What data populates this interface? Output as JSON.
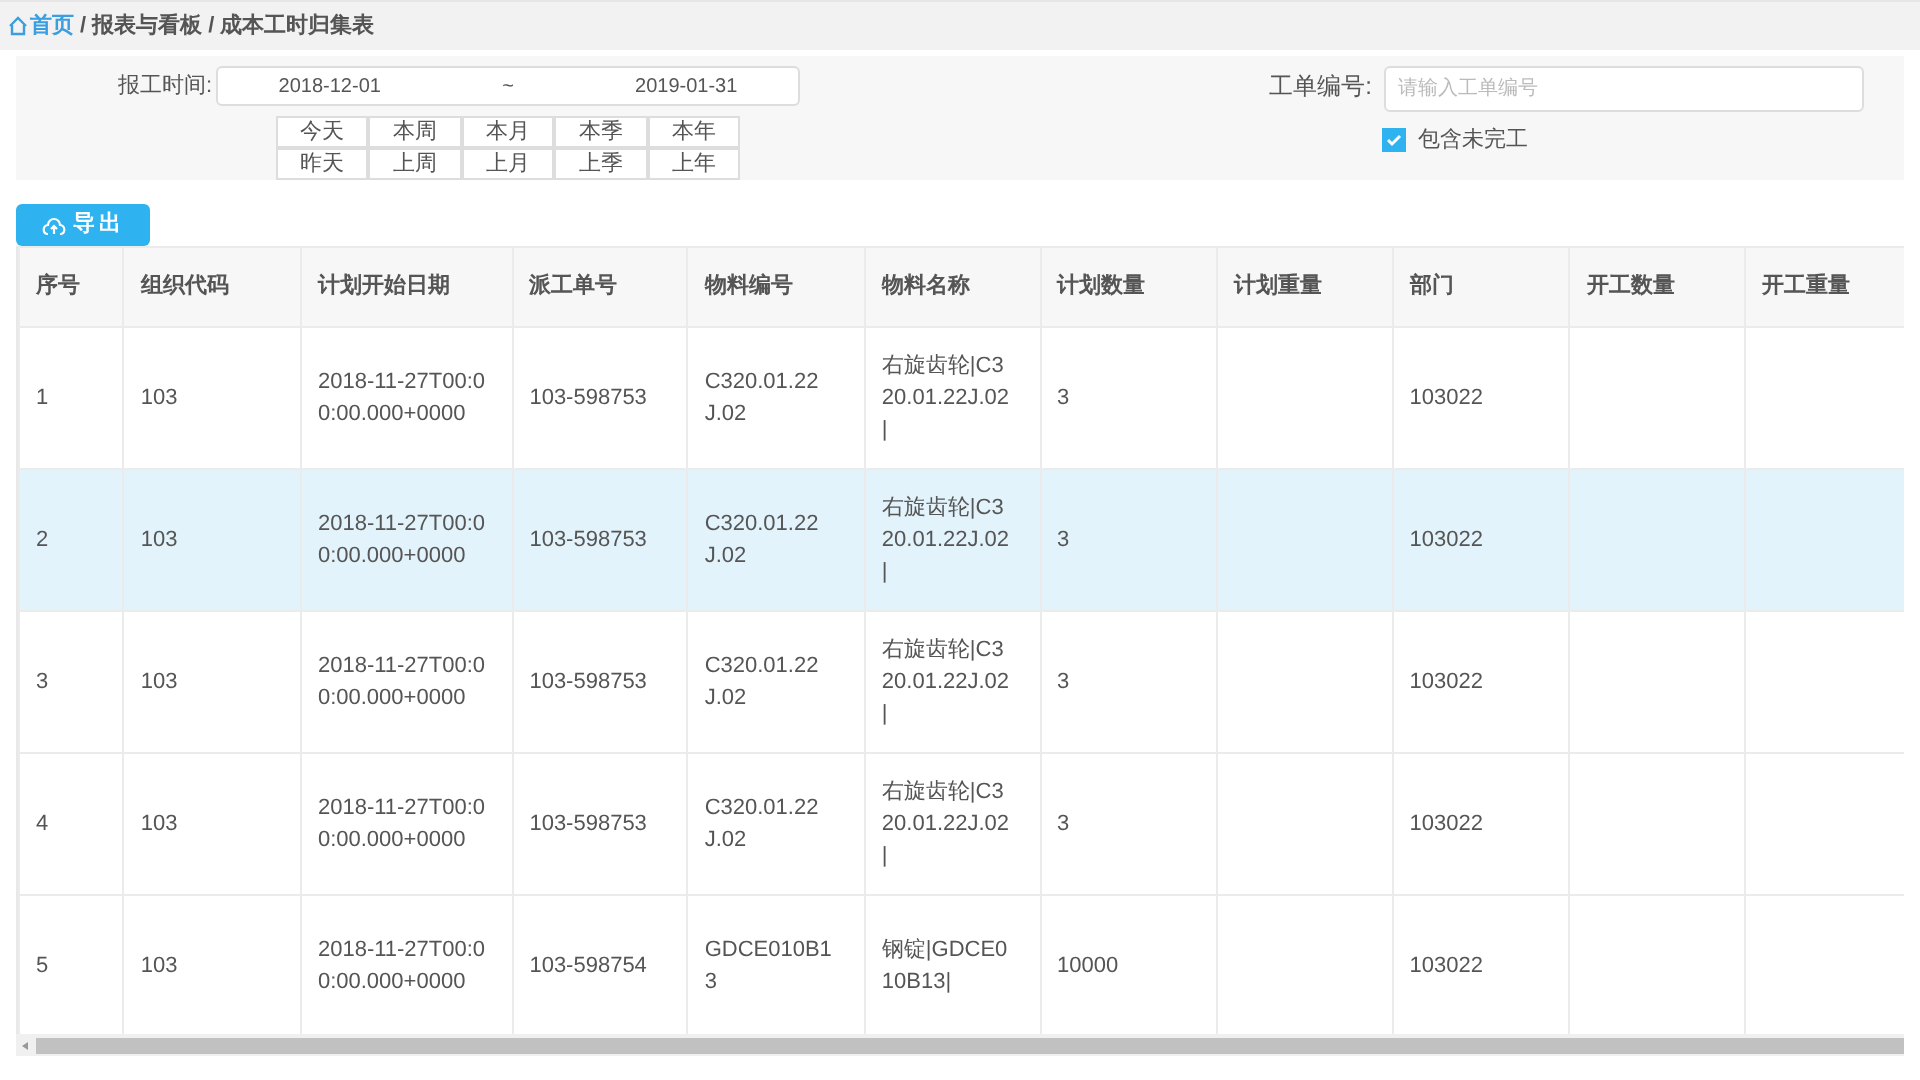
{
  "breadcrumb": {
    "home": "首页",
    "separator": "/",
    "items": [
      "报表与看板",
      "成本工时归集表"
    ]
  },
  "filter": {
    "date_label": "报工时间:",
    "date_start": "2018-12-01",
    "date_sep": "~",
    "date_end": "2019-01-31",
    "quick_ranges": [
      "今天",
      "本周",
      "本月",
      "本季",
      "本年",
      "昨天",
      "上周",
      "上月",
      "上季",
      "上年"
    ],
    "order_label": "工单编号:",
    "order_placeholder": "请输入工单编号",
    "include_unfinished": {
      "label": "包含未完工",
      "checked": true
    }
  },
  "export_button": "导出",
  "table": {
    "columns": [
      "序号",
      "组织代码",
      "计划开始日期",
      "派工单号",
      "物料编号",
      "物料名称",
      "计划数量",
      "计划重量",
      "部门",
      "开工数量",
      "开工重量"
    ],
    "rows": [
      {
        "selected": false,
        "cells": [
          "1",
          "103",
          "2018-11-27T00:00:00.000+0000",
          "103-598753",
          "C320.01.22J.02",
          "右旋齿轮|C320.01.22J.02|",
          "3",
          "",
          "103022",
          "",
          ""
        ]
      },
      {
        "selected": true,
        "cells": [
          "2",
          "103",
          "2018-11-27T00:00:00.000+0000",
          "103-598753",
          "C320.01.22J.02",
          "右旋齿轮|C320.01.22J.02|",
          "3",
          "",
          "103022",
          "",
          ""
        ]
      },
      {
        "selected": false,
        "cells": [
          "3",
          "103",
          "2018-11-27T00:00:00.000+0000",
          "103-598753",
          "C320.01.22J.02",
          "右旋齿轮|C320.01.22J.02|",
          "3",
          "",
          "103022",
          "",
          ""
        ]
      },
      {
        "selected": false,
        "cells": [
          "4",
          "103",
          "2018-11-27T00:00:00.000+0000",
          "103-598753",
          "C320.01.22J.02",
          "右旋齿轮|C320.01.22J.02|",
          "3",
          "",
          "103022",
          "",
          ""
        ]
      },
      {
        "selected": false,
        "cells": [
          "5",
          "103",
          "2018-11-27T00:00:00.000+0000",
          "103-598754",
          "GDCE010B13",
          "钢锭|GDCE010B13|",
          "10000",
          "",
          "103022",
          "",
          ""
        ]
      }
    ]
  }
}
